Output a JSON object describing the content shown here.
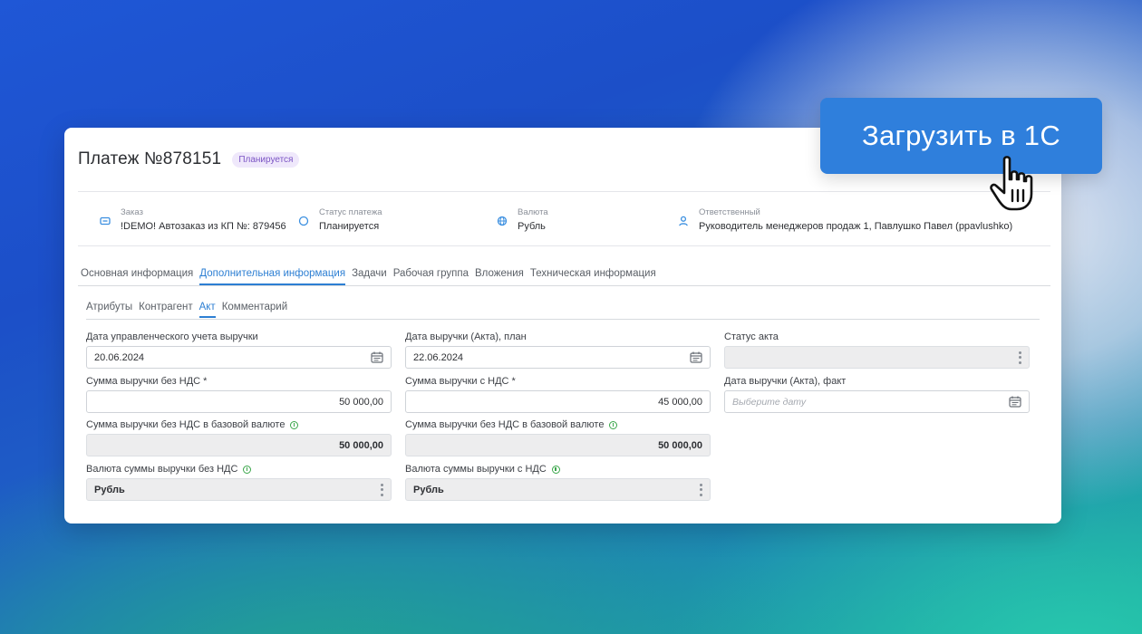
{
  "header": {
    "title": "Платеж №878151",
    "status_badge": "Планируется"
  },
  "info": [
    {
      "label": "Заказ",
      "value": "!DEMO! Автозаказ из КП №: 879456",
      "icon": "order-icon"
    },
    {
      "label": "Статус платежа",
      "value": "Планируется",
      "icon": "status-circle-icon"
    },
    {
      "label": "Валюта",
      "value": "Рубль",
      "icon": "globe-icon"
    },
    {
      "label": "Ответственный",
      "value": "Руководитель менеджеров продаж 1, Павлушко Павел (ppavlushko)",
      "icon": "user-icon"
    }
  ],
  "tabs": [
    {
      "label": "Основная информация"
    },
    {
      "label": "Дополнительная информация",
      "active": true
    },
    {
      "label": "Задачи"
    },
    {
      "label": "Рабочая группа"
    },
    {
      "label": "Вложения"
    },
    {
      "label": "Техническая информация"
    }
  ],
  "subtabs": [
    {
      "label": "Атрибуты"
    },
    {
      "label": "Контрагент"
    },
    {
      "label": "Акт",
      "active": true
    },
    {
      "label": "Комментарий"
    }
  ],
  "fields": {
    "mgmt_date": {
      "label": "Дата управленческого учета выручки",
      "value": "20.06.2024"
    },
    "revenue_date_plan": {
      "label": "Дата выручки (Акта), план",
      "value": "22.06.2024"
    },
    "act_status": {
      "label": "Статус акта",
      "value": ""
    },
    "sum_no_vat": {
      "label": "Сумма выручки без НДС *",
      "value": "50 000,00"
    },
    "sum_with_vat": {
      "label": "Сумма выручки с НДС *",
      "value": "45 000,00"
    },
    "revenue_date_fact": {
      "label": "Дата выручки (Акта), факт",
      "placeholder": "Выберите дату"
    },
    "sum_no_vat_base_1": {
      "label": "Сумма выручки без НДС в базовой валюте",
      "value": "50 000,00"
    },
    "sum_no_vat_base_2": {
      "label": "Сумма выручки без НДС в базовой валюте",
      "value": "50 000,00"
    },
    "currency_no_vat": {
      "label": "Валюта суммы выручки без НДС",
      "value": "Рубль"
    },
    "currency_with_vat": {
      "label": "Валюта суммы выручки с НДС",
      "value": "Рубль"
    }
  },
  "cta": {
    "label": "Загрузить в 1С"
  },
  "colors": {
    "accent": "#2f7fdc",
    "badge_text": "#7b54c4",
    "info_green": "#3aa64a"
  }
}
